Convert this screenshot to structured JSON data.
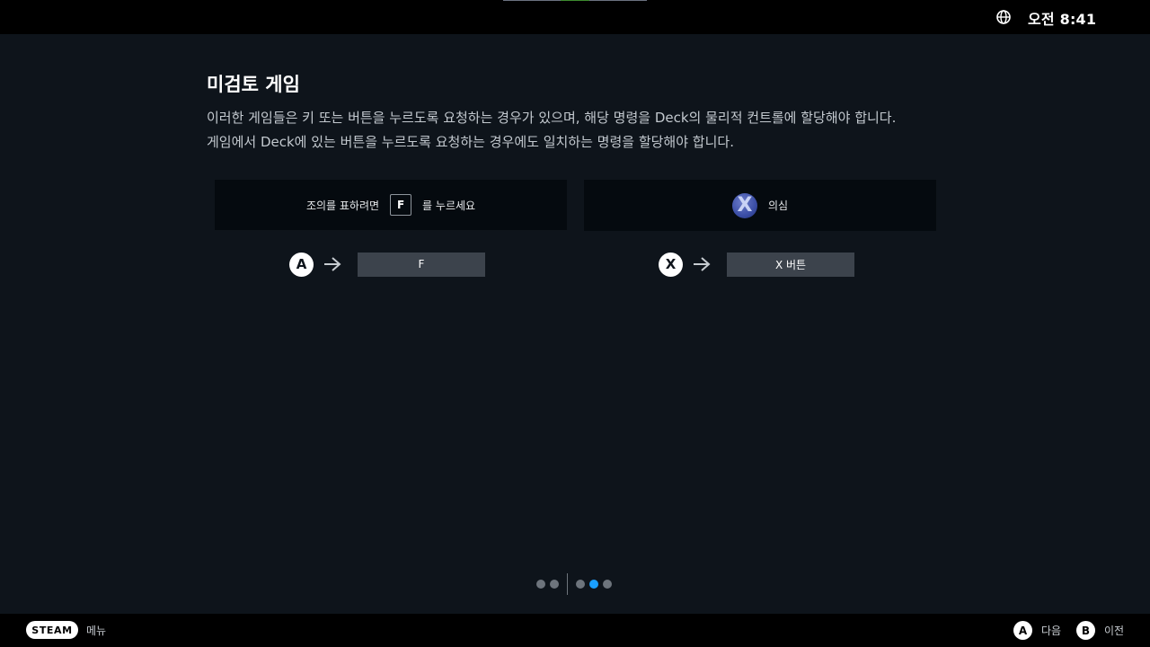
{
  "status_bar": {
    "time": "오전 8:41"
  },
  "page": {
    "title": "미검토 게임",
    "desc_line1": "이러한 게임들은 키 또는 버튼을 누르도록 요청하는 경우가 있으며, 해당 명령을 Deck의 물리적 컨트롤에 할당해야 합니다.",
    "desc_line2": "게임에서 Deck에 있는 버튼을 누르도록 요청하는 경우에도 일치하는 명령을 할당해야 합니다."
  },
  "example_left": {
    "prompt_before": "조의를 표하려면",
    "key": "F",
    "prompt_after": "를 누르세요",
    "mapping_button": "A",
    "mapping_target": "F"
  },
  "example_right": {
    "icon_glyph": "X",
    "prompt": "의심",
    "mapping_button": "X",
    "mapping_target": "X 버튼"
  },
  "pager": {
    "group1_count": 2,
    "group2_count": 3,
    "active_index": 3
  },
  "footer": {
    "steam_label": "STEAM",
    "menu_label": "메뉴",
    "a_button": "A",
    "next_label": "다음",
    "b_button": "B",
    "prev_label": "이전"
  },
  "colors": {
    "accent": "#1a9fff",
    "background": "#0e141b",
    "panel": "#050a0f",
    "bind_box": "#3c434c"
  }
}
